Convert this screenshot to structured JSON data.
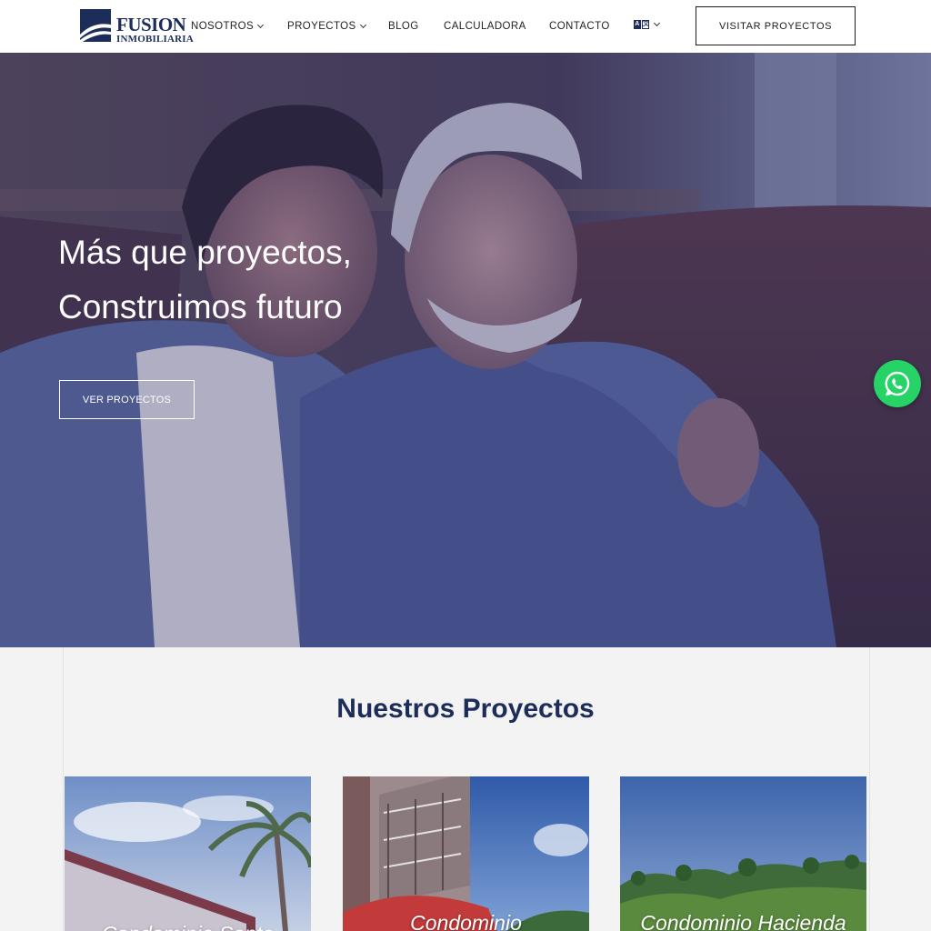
{
  "brand": {
    "name": "FUSION",
    "subtitle": "INMOBILIARIA",
    "colors": {
      "navy": "#1c2d5a",
      "whatsapp": "#25d366",
      "hero_overlay": "#3b3f6a"
    }
  },
  "nav": {
    "items": [
      {
        "label": "NOSOTROS",
        "has_dropdown": true
      },
      {
        "label": "PROYECTOS",
        "has_dropdown": true
      },
      {
        "label": "BLOG",
        "has_dropdown": false
      },
      {
        "label": "CALCULADORA",
        "has_dropdown": false
      },
      {
        "label": "CONTACTO",
        "has_dropdown": false
      }
    ],
    "language_icon": "translate-icon",
    "cta_label": "VISITAR PROYECTOS"
  },
  "hero": {
    "line1": "Más que proyectos,",
    "line2": "Construimos futuro",
    "button_label": "VER PROYECTOS"
  },
  "whatsapp": {
    "icon": "whatsapp-icon"
  },
  "projects": {
    "heading": "Nuestros Proyectos",
    "cards": [
      {
        "title": "Condominio Santa"
      },
      {
        "title": "Condominio"
      },
      {
        "title": "Condominio Hacienda"
      }
    ]
  }
}
